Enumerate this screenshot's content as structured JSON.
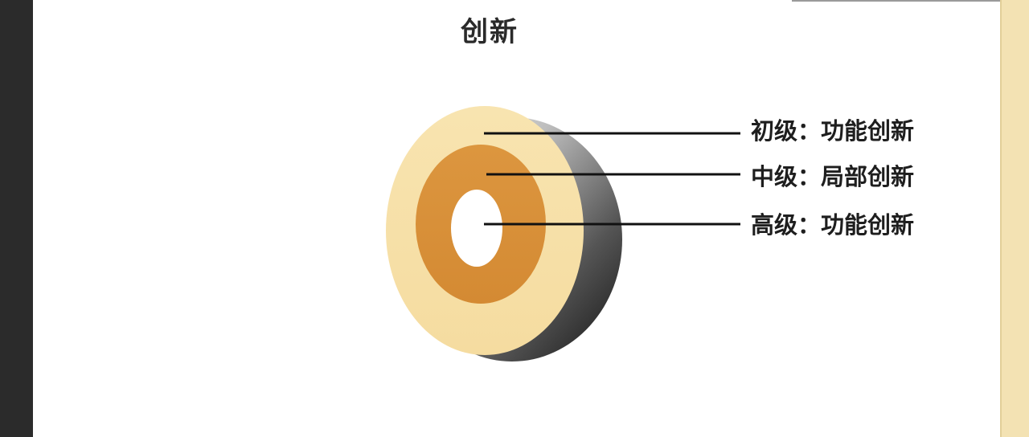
{
  "title": "创新",
  "levels": [
    {
      "label": "初级：功能创新",
      "ring": "outer",
      "color": "#f6dfa5"
    },
    {
      "label": "中级：局部创新",
      "ring": "middle",
      "color": "#d9913b"
    },
    {
      "label": "高级：功能创新",
      "ring": "inner",
      "color": "#ffffff"
    }
  ],
  "colors": {
    "outer_ring": "#f6dfa5",
    "middle_ring": "#d9913b",
    "side_dark": "#1f1f1f",
    "side_light": "#d8d8d8",
    "leader_line": "#111111",
    "left_bar": "#2b2b2b",
    "right_bar": "#f3e2b3"
  }
}
